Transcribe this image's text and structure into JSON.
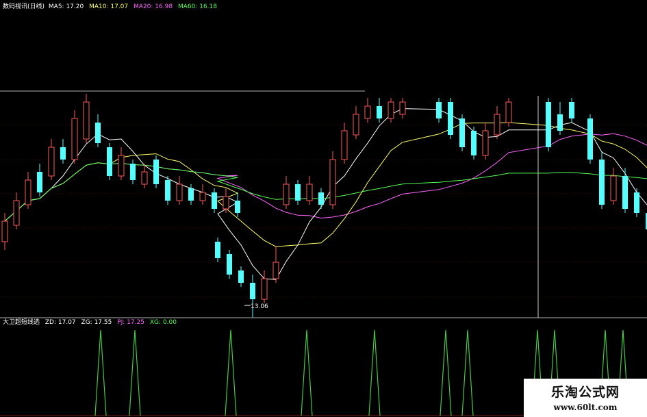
{
  "legend_top": {
    "title": "数码视讯(日线)",
    "ma5": "MA5: 17.20",
    "ma10": "MA10: 17.07",
    "ma20": "MA20: 16.98",
    "ma60": "MA60: 16.18"
  },
  "legend_bottom": {
    "title": "大卫超短线选",
    "zd": "ZD: 17.07",
    "zg": "ZG: 17.55",
    "pj": "PJ: 17.25",
    "xg": "XG: 0.00"
  },
  "low_label": "13.06",
  "watermark": {
    "cn": "乐淘公式网",
    "url": "www.60lt.com"
  },
  "colors": {
    "up": "#ff5a5a",
    "down": "#54ffff",
    "ma5": "#ffffff",
    "ma10": "#ffff66",
    "ma20": "#ff66ff",
    "ma60": "#55ff55",
    "signal": "#44cc44",
    "grid": "#7a1a1a",
    "separator": "#b0b0b0"
  },
  "chart_data": [
    {
      "type": "candlestick",
      "title": "数码视讯(日线)",
      "series": [
        {
          "name": "MA5",
          "last": 17.2
        },
        {
          "name": "MA10",
          "last": 17.07
        },
        {
          "name": "MA20",
          "last": 16.98
        },
        {
          "name": "MA60",
          "last": 16.18
        }
      ],
      "annotations": [
        {
          "text": "13.06",
          "kind": "period-low"
        }
      ],
      "approx_candles": [
        {
          "d": "up",
          "o": 14.9,
          "c": 15.4,
          "h": 15.6,
          "l": 14.7
        },
        {
          "d": "up",
          "o": 15.3,
          "c": 15.9,
          "h": 16.1,
          "l": 15.2
        },
        {
          "d": "up",
          "o": 15.8,
          "c": 16.4,
          "h": 16.6,
          "l": 15.7
        },
        {
          "d": "down",
          "o": 16.6,
          "c": 16.1,
          "h": 16.8,
          "l": 16.0
        },
        {
          "d": "up",
          "o": 16.5,
          "c": 17.2,
          "h": 17.4,
          "l": 16.4
        },
        {
          "d": "down",
          "o": 17.2,
          "c": 16.9,
          "h": 17.4,
          "l": 16.8
        },
        {
          "d": "up",
          "o": 16.9,
          "c": 17.9,
          "h": 18.1,
          "l": 16.8
        },
        {
          "d": "up",
          "o": 17.4,
          "c": 18.3,
          "h": 18.5,
          "l": 17.3
        },
        {
          "d": "down",
          "o": 17.8,
          "c": 17.3,
          "h": 18.0,
          "l": 17.2
        },
        {
          "d": "down",
          "o": 17.2,
          "c": 16.5,
          "h": 17.3,
          "l": 16.4
        },
        {
          "d": "up",
          "o": 16.5,
          "c": 17.0,
          "h": 17.2,
          "l": 16.4
        },
        {
          "d": "down",
          "o": 16.8,
          "c": 16.4,
          "h": 16.9,
          "l": 16.3
        },
        {
          "d": "up",
          "o": 16.3,
          "c": 16.6,
          "h": 16.8,
          "l": 16.2
        },
        {
          "d": "down",
          "o": 16.9,
          "c": 16.3,
          "h": 17.0,
          "l": 16.2
        },
        {
          "d": "down",
          "o": 16.4,
          "c": 15.9,
          "h": 16.5,
          "l": 15.8
        },
        {
          "d": "up",
          "o": 15.9,
          "c": 16.3,
          "h": 16.5,
          "l": 15.8
        },
        {
          "d": "down",
          "o": 16.2,
          "c": 15.9,
          "h": 16.3,
          "l": 15.8
        },
        {
          "d": "up",
          "o": 15.9,
          "c": 16.1,
          "h": 16.3,
          "l": 15.8
        },
        {
          "d": "down",
          "o": 16.1,
          "c": 15.7,
          "h": 16.2,
          "l": 15.6
        },
        {
          "d": "up",
          "o": 15.7,
          "c": 16.0,
          "h": 16.2,
          "l": 15.6
        },
        {
          "d": "down",
          "o": 15.9,
          "c": 15.6,
          "h": 16.1,
          "l": 15.5
        },
        {
          "d": "down",
          "o": 14.9,
          "c": 14.5,
          "h": 15.0,
          "l": 14.4
        },
        {
          "d": "down",
          "o": 14.6,
          "c": 14.1,
          "h": 14.7,
          "l": 14.0
        },
        {
          "d": "down",
          "o": 14.2,
          "c": 13.9,
          "h": 14.3,
          "l": 13.8
        },
        {
          "d": "down",
          "o": 13.9,
          "c": 13.5,
          "h": 14.1,
          "l": 13.06
        },
        {
          "d": "up",
          "o": 13.5,
          "c": 14.0,
          "h": 14.2,
          "l": 13.4
        },
        {
          "d": "up",
          "o": 14.0,
          "c": 14.4,
          "h": 14.8,
          "l": 13.9
        },
        {
          "d": "up",
          "o": 15.8,
          "c": 16.3,
          "h": 16.5,
          "l": 15.7
        },
        {
          "d": "down",
          "o": 16.3,
          "c": 15.9,
          "h": 16.4,
          "l": 15.8
        },
        {
          "d": "up",
          "o": 15.9,
          "c": 16.3,
          "h": 16.5,
          "l": 15.8
        },
        {
          "d": "down",
          "o": 16.1,
          "c": 15.8,
          "h": 16.2,
          "l": 15.7
        },
        {
          "d": "up",
          "o": 15.8,
          "c": 16.9,
          "h": 17.1,
          "l": 15.7
        },
        {
          "d": "up",
          "o": 16.9,
          "c": 17.6,
          "h": 17.8,
          "l": 16.8
        },
        {
          "d": "up",
          "o": 17.5,
          "c": 18.0,
          "h": 18.2,
          "l": 17.4
        },
        {
          "d": "up",
          "o": 17.9,
          "c": 18.2,
          "h": 18.4,
          "l": 17.8
        },
        {
          "d": "down",
          "o": 18.2,
          "c": 17.9,
          "h": 18.4,
          "l": 17.8
        },
        {
          "d": "up",
          "o": 17.9,
          "c": 18.3,
          "h": 18.4,
          "l": 17.8
        },
        {
          "d": "up",
          "o": 18.0,
          "c": 18.3,
          "h": 18.4,
          "l": 17.9
        },
        {
          "d": "down",
          "o": 18.3,
          "c": 17.9,
          "h": 18.4,
          "l": 17.8
        },
        {
          "d": "down",
          "o": 18.3,
          "c": 17.5,
          "h": 18.4,
          "l": 17.4
        },
        {
          "d": "down",
          "o": 17.9,
          "c": 17.2,
          "h": 18.0,
          "l": 17.1
        },
        {
          "d": "down",
          "o": 17.6,
          "c": 17.0,
          "h": 17.7,
          "l": 16.9
        },
        {
          "d": "up",
          "o": 17.0,
          "c": 17.6,
          "h": 17.8,
          "l": 16.9
        },
        {
          "d": "up",
          "o": 17.5,
          "c": 18.0,
          "h": 18.2,
          "l": 17.4
        },
        {
          "d": "up",
          "o": 17.8,
          "c": 18.3,
          "h": 18.4,
          "l": 17.7
        },
        {
          "d": "down",
          "o": 18.3,
          "c": 17.2,
          "h": 18.4,
          "l": 17.1
        },
        {
          "d": "down",
          "o": 18.0,
          "c": 17.6,
          "h": 18.3,
          "l": 17.5
        },
        {
          "d": "down",
          "o": 18.3,
          "c": 17.9,
          "h": 18.4,
          "l": 17.8
        },
        {
          "d": "down",
          "o": 17.9,
          "c": 16.9,
          "h": 18.0,
          "l": 16.8
        },
        {
          "d": "down",
          "o": 16.9,
          "c": 15.8,
          "h": 17.1,
          "l": 15.7
        },
        {
          "d": "up",
          "o": 15.9,
          "c": 16.5,
          "h": 16.7,
          "l": 15.8
        },
        {
          "d": "down",
          "o": 16.5,
          "c": 15.7,
          "h": 16.7,
          "l": 15.6
        },
        {
          "d": "down",
          "o": 16.1,
          "c": 15.6,
          "h": 16.2,
          "l": 15.5
        },
        {
          "d": "down",
          "o": 15.6,
          "c": 15.2,
          "h": 15.7,
          "l": 14.6
        }
      ]
    },
    {
      "type": "line",
      "title": "大卫超短线选",
      "series": [
        {
          "name": "ZD",
          "last": 17.07
        },
        {
          "name": "ZG",
          "last": 17.55
        },
        {
          "name": "PJ",
          "last": 17.25
        },
        {
          "name": "XG",
          "last": 0.0
        }
      ],
      "signal_count": 11
    }
  ]
}
